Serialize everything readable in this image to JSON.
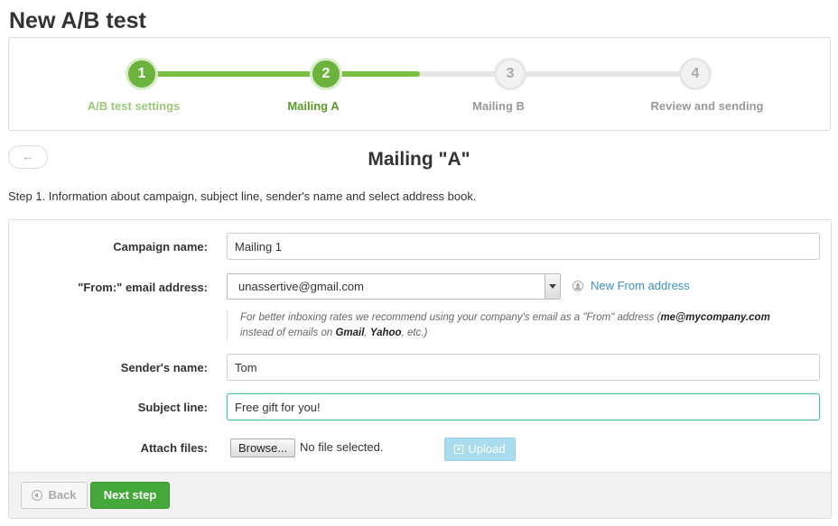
{
  "page": {
    "title": "New A/B test"
  },
  "stepper": {
    "steps": [
      {
        "number": "1",
        "label": "A/B test settings",
        "state": "done"
      },
      {
        "number": "2",
        "label": "Mailing A",
        "state": "active"
      },
      {
        "number": "3",
        "label": "Mailing B",
        "state": "pending"
      },
      {
        "number": "4",
        "label": "Review and sending",
        "state": "pending"
      }
    ],
    "colors": {
      "complete": "#6cb33e",
      "pending": "#e6e6e6"
    }
  },
  "header": {
    "back_arrow": "←",
    "section_title": "Mailing \"A\"",
    "step_description": "Step 1. Information about campaign, subject line, sender's name and select address book."
  },
  "form": {
    "campaign_name": {
      "label": "Campaign name:",
      "value": "Mailing 1"
    },
    "from_email": {
      "label": "\"From:\" email address:",
      "selected": "unassertive@gmail.com",
      "new_from_link": "New From address"
    },
    "hint": {
      "part1": "For better inboxing rates we recommend using your company's email as a \"From\" address (",
      "example_email": "me@mycompany.com",
      "part2": "instead of emails on ",
      "gmail": "Gmail",
      "comma": ", ",
      "yahoo": "Yahoo",
      "part3": ", etc.)"
    },
    "sender_name": {
      "label": "Sender's name:",
      "value": "Tom"
    },
    "subject_line": {
      "label": "Subject line:",
      "value": "Free gift for you!"
    },
    "attach_files": {
      "label": "Attach files:",
      "browse_label": "Browse...",
      "no_file_text": "No file selected.",
      "upload_label": "Upload"
    }
  },
  "footer": {
    "back_label": "Back",
    "next_label": "Next step"
  },
  "colors": {
    "accent_green": "#44a83a",
    "link_blue": "#3d8fc6",
    "upload_disabled": "#a9dcee",
    "focus_border": "#4fc3a1"
  }
}
